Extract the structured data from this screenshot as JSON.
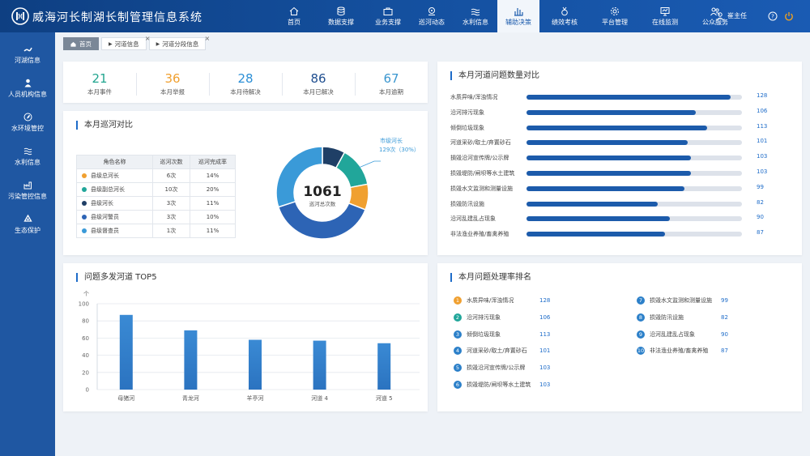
{
  "app": {
    "title": "威海河长制湖长制管理信息系统"
  },
  "nav": [
    {
      "label": "首页",
      "icon": "home-icon"
    },
    {
      "label": "数据支撑",
      "icon": "database-icon"
    },
    {
      "label": "业务支撑",
      "icon": "briefcase-icon"
    },
    {
      "label": "巡河动态",
      "icon": "location-icon"
    },
    {
      "label": "水利信息",
      "icon": "water-icon"
    },
    {
      "label": "辅助决策",
      "icon": "bar-chart-icon",
      "active": true
    },
    {
      "label": "绩效考核",
      "icon": "medal-icon"
    },
    {
      "label": "平台管理",
      "icon": "gear-icon"
    },
    {
      "label": "在线监测",
      "icon": "monitor-icon"
    },
    {
      "label": "公众服务",
      "icon": "people-icon"
    }
  ],
  "user": {
    "name": "崔主任"
  },
  "sidebar": [
    {
      "label": "河湖信息",
      "icon": "river-icon"
    },
    {
      "label": "人员机构信息",
      "icon": "person-icon"
    },
    {
      "label": "水环境管控",
      "icon": "eco-icon"
    },
    {
      "label": "水利信息",
      "icon": "water-icon"
    },
    {
      "label": "污染管控信息",
      "icon": "pollution-icon"
    },
    {
      "label": "生态保护",
      "icon": "recycle-icon"
    }
  ],
  "tabs": [
    {
      "label": "首页",
      "home": true
    },
    {
      "label": "河道信息"
    },
    {
      "label": "河道分段信息"
    }
  ],
  "stats": [
    {
      "value": "21",
      "label": "本月事件",
      "color": "#22a58f"
    },
    {
      "value": "36",
      "label": "本月举报",
      "color": "#f0a030"
    },
    {
      "value": "28",
      "label": "本月待解决",
      "color": "#2c8fd6"
    },
    {
      "value": "86",
      "label": "本月已解决",
      "color": "#1f4e8f"
    },
    {
      "value": "67",
      "label": "本月逾期",
      "color": "#3a96cf"
    }
  ],
  "patrol": {
    "title": "本月巡河对比",
    "headers": [
      "角色名称",
      "巡河次数",
      "巡河完成率"
    ],
    "rows": [
      {
        "name": "县级总河长",
        "count": "6次",
        "rate": "14%",
        "color": "#f0a030"
      },
      {
        "name": "县级副总河长",
        "count": "10次",
        "rate": "20%",
        "color": "#21a69a"
      },
      {
        "name": "县级河长",
        "count": "3次",
        "rate": "11%",
        "color": "#1f3f66"
      },
      {
        "name": "县级河警员",
        "count": "3次",
        "rate": "10%",
        "color": "#2d64b5"
      },
      {
        "name": "县级督查员",
        "count": "1次",
        "rate": "11%",
        "color": "#3a9ad8"
      }
    ],
    "donut": {
      "total": "1061",
      "total_label": "巡河总次数",
      "callout_title": "市级河长",
      "callout_value": "129次（30%）",
      "segments": [
        {
          "color": "#1f3f66",
          "frac": 0.08
        },
        {
          "color": "#21a69a",
          "frac": 0.14
        },
        {
          "color": "#f0a030",
          "frac": 0.09
        },
        {
          "color": "#2d64b5",
          "frac": 0.39
        },
        {
          "color": "#3a9ad8",
          "frac": 0.3
        }
      ]
    }
  },
  "problems": {
    "title": "本月河道问题数量对比",
    "max": 135,
    "items": [
      {
        "label": "水质异味/浑浊情况",
        "value": 128
      },
      {
        "label": "沿河排污现象",
        "value": 106
      },
      {
        "label": "倾倒垃圾现象",
        "value": 113
      },
      {
        "label": "河道采砂/取土/弃置砂石",
        "value": 101
      },
      {
        "label": "損毁沿河宣传牌/公示牌",
        "value": 103
      },
      {
        "label": "损毁堤防/闸坝等水土建筑",
        "value": 103
      },
      {
        "label": "损毁水文监测和测量设施",
        "value": 99
      },
      {
        "label": "损毁防汛设施",
        "value": 82
      },
      {
        "label": "沿河乱建乱占现象",
        "value": 90
      },
      {
        "label": "非法渔业养殖/畜禽养殖",
        "value": 87
      }
    ]
  },
  "top5": {
    "title": "问题多发河道 TOP5",
    "chart_data": {
      "type": "bar",
      "categories": [
        "母猪河",
        "青龙河",
        "羊亭河",
        "河道 4",
        "河道 5"
      ],
      "values": [
        87,
        69,
        58,
        57,
        54
      ],
      "ylabel": "个",
      "ylim": [
        0,
        100
      ],
      "yticks": [
        "0",
        "20",
        "40",
        "60",
        "80",
        "100"
      ]
    }
  },
  "ranking": {
    "title": "本月问题处理率排名",
    "items": [
      {
        "rank": "1",
        "label": "水质异味/浑浊情况",
        "value": "128",
        "color": "#f0a030"
      },
      {
        "rank": "2",
        "label": "沿河排污现象",
        "value": "106",
        "color": "#21a69a"
      },
      {
        "rank": "3",
        "label": "倾倒垃圾现象",
        "value": "113",
        "color": "#2c80c9"
      },
      {
        "rank": "4",
        "label": "河道采砂/取土/弃置砂石",
        "value": "101",
        "color": "#2c80c9"
      },
      {
        "rank": "5",
        "label": "损毁沿河宣传牌/公示牌",
        "value": "103",
        "color": "#2c80c9"
      },
      {
        "rank": "6",
        "label": "损毁堤防/闸坝等水土建筑",
        "value": "103",
        "color": "#2c80c9"
      },
      {
        "rank": "7",
        "label": "损毁水文监测和测量设施",
        "value": "99",
        "color": "#2c80c9"
      },
      {
        "rank": "8",
        "label": "损毁防汛设施",
        "value": "82",
        "color": "#2c80c9"
      },
      {
        "rank": "9",
        "label": "沿河乱建乱占现象",
        "value": "90",
        "color": "#2c80c9"
      },
      {
        "rank": "10",
        "label": "非法渔业养殖/畜禽养殖",
        "value": "87",
        "color": "#2c80c9"
      }
    ]
  }
}
